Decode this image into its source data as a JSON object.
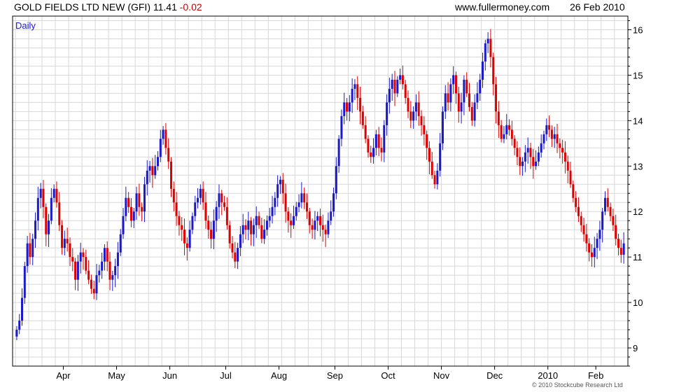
{
  "header": {
    "title": "GOLD FIELDS LTD NEW (GFI)",
    "last": "11.41",
    "change": "-0.02",
    "site": "www.fullermoney.com",
    "date": "26 Feb 2010"
  },
  "footer": {
    "copyright": "© 2010 Stockcube Research Ltd"
  },
  "colors": {
    "up": "#1a1acc",
    "down": "#e00000",
    "grid": "#d8d8d8"
  },
  "chart_data": {
    "type": "candlestick",
    "period_label": "Daily",
    "ylim": [
      8.6,
      16.3
    ],
    "yticks": [
      9,
      10,
      11,
      12,
      13,
      14,
      15,
      16
    ],
    "y_axis_side": "right",
    "months": [
      {
        "label": "Apr",
        "start_index": 18
      },
      {
        "label": "May",
        "start_index": 38
      },
      {
        "label": "Jun",
        "start_index": 58
      },
      {
        "label": "Jul",
        "start_index": 79
      },
      {
        "label": "Aug",
        "start_index": 99
      },
      {
        "label": "Sep",
        "start_index": 120
      },
      {
        "label": "Oct",
        "start_index": 140
      },
      {
        "label": "Nov",
        "start_index": 160
      },
      {
        "label": "Dec",
        "start_index": 180
      },
      {
        "label": "2010",
        "start_index": 200
      },
      {
        "label": "Feb",
        "start_index": 218
      }
    ],
    "closes": [
      9.4,
      9.6,
      10.1,
      10.8,
      11.3,
      11.0,
      11.4,
      11.8,
      12.3,
      12.5,
      12.1,
      11.5,
      11.8,
      12.3,
      12.5,
      12.2,
      11.7,
      11.2,
      11.4,
      11.3,
      11.0,
      10.9,
      10.5,
      10.9,
      11.1,
      11.0,
      10.7,
      10.5,
      10.3,
      10.2,
      10.6,
      10.7,
      10.9,
      11.2,
      10.9,
      10.5,
      10.6,
      10.8,
      11.1,
      11.5,
      11.9,
      12.3,
      12.1,
      11.8,
      12.0,
      12.4,
      12.1,
      12.0,
      12.6,
      12.9,
      13.0,
      12.8,
      13.0,
      13.2,
      13.6,
      13.8,
      13.4,
      13.1,
      12.5,
      12.2,
      11.9,
      11.7,
      11.6,
      11.3,
      11.2,
      11.6,
      11.9,
      12.2,
      12.3,
      12.5,
      12.2,
      11.8,
      11.6,
      11.4,
      11.8,
      12.1,
      12.4,
      12.2,
      12.1,
      11.7,
      11.3,
      11.1,
      10.9,
      11.2,
      11.5,
      11.7,
      11.6,
      11.8,
      11.5,
      11.7,
      11.9,
      11.7,
      11.4,
      11.6,
      11.8,
      11.9,
      12.1,
      12.3,
      12.6,
      12.7,
      12.4,
      12.0,
      11.8,
      11.7,
      11.9,
      12.1,
      12.2,
      12.4,
      12.2,
      12.0,
      11.7,
      11.6,
      11.8,
      11.9,
      11.7,
      11.6,
      11.5,
      11.8,
      12.0,
      12.4,
      13.0,
      13.6,
      14.1,
      14.4,
      14.2,
      14.4,
      14.7,
      14.8,
      14.5,
      14.2,
      13.9,
      13.6,
      13.3,
      13.2,
      13.4,
      13.7,
      13.4,
      13.3,
      13.9,
      14.4,
      14.7,
      14.9,
      14.6,
      14.9,
      15.0,
      14.8,
      14.5,
      14.2,
      14.0,
      14.2,
      14.4,
      14.1,
      13.9,
      13.7,
      13.4,
      13.1,
      12.8,
      12.6,
      12.9,
      13.5,
      14.2,
      14.6,
      14.4,
      14.8,
      15.0,
      14.6,
      14.2,
      14.4,
      14.9,
      14.6,
      14.3,
      14.0,
      14.4,
      14.6,
      14.9,
      15.3,
      15.7,
      15.8,
      15.4,
      14.8,
      14.2,
      13.9,
      13.6,
      13.7,
      13.9,
      13.8,
      13.6,
      13.4,
      13.2,
      13.0,
      13.1,
      13.3,
      13.4,
      13.2,
      13.0,
      13.1,
      13.3,
      13.5,
      13.7,
      13.9,
      13.8,
      13.6,
      13.7,
      13.5,
      13.4,
      13.3,
      13.1,
      12.9,
      12.6,
      12.3,
      12.1,
      11.9,
      11.7,
      11.5,
      11.3,
      11.1,
      11.0,
      11.2,
      11.4,
      11.6,
      12.0,
      12.3,
      12.1,
      11.9,
      11.7,
      11.4,
      11.2,
      11.05,
      11.3
    ]
  }
}
